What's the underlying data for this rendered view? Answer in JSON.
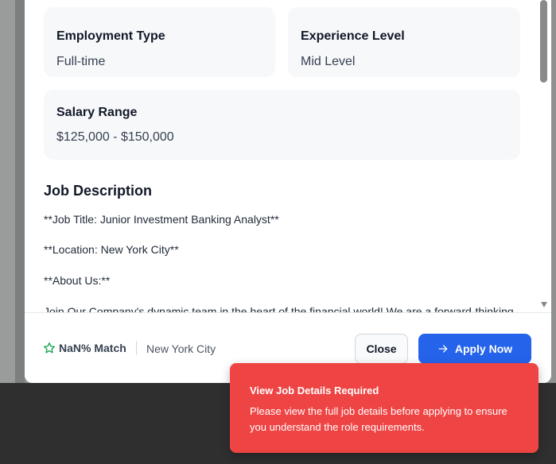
{
  "cards": {
    "employment_type": {
      "label": "Employment Type",
      "value": "Full-time"
    },
    "experience_level": {
      "label": "Experience Level",
      "value": "Mid Level"
    },
    "salary_range": {
      "label": "Salary Range",
      "value": "$125,000 - $150,000"
    }
  },
  "description": {
    "title": "Job Description",
    "lines": [
      "**Job Title: Junior Investment Banking Analyst**",
      "**Location: New York City**",
      "**About Us:**",
      "Join Our Company's dynamic team in the heart of the financial world! We are a forward-thinking"
    ]
  },
  "footer": {
    "match": "NaN% Match",
    "location": "New York City",
    "close_label": "Close",
    "apply_label": "Apply Now"
  },
  "toast": {
    "title": "View Job Details Required",
    "body": "Please view the full job details before applying to ensure you understand the role requirements."
  },
  "colors": {
    "primary": "#2563eb",
    "toast": "#ef4444",
    "star": "#16a34a"
  },
  "icons": {
    "match": "star-outline-icon",
    "apply": "arrow-right-icon"
  }
}
